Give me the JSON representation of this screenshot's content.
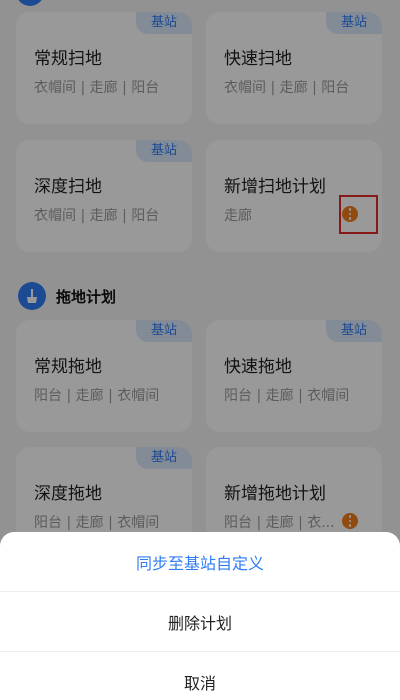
{
  "badge_label": "基站",
  "section": {
    "title": "拖地计划"
  },
  "cards": [
    {
      "title": "常规扫地",
      "rooms": "衣帽间 | 走廊 | 阳台"
    },
    {
      "title": "快速扫地",
      "rooms": "衣帽间 | 走廊 | 阳台"
    },
    {
      "title": "深度扫地",
      "rooms": "衣帽间 | 走廊 | 阳台"
    },
    {
      "title": "新增扫地计划",
      "rooms": "走廊"
    },
    {
      "title": "常规拖地",
      "rooms": "阳台 | 走廊 | 衣帽间"
    },
    {
      "title": "快速拖地",
      "rooms": "阳台 | 走廊 | 衣帽间"
    },
    {
      "title": "深度拖地",
      "rooms": "阳台 | 走廊 | 衣帽间"
    },
    {
      "title": "新增拖地计划",
      "rooms": "阳台 | 走廊 | 衣..."
    }
  ],
  "sheet": {
    "sync": "同步至基站自定义",
    "delete": "删除计划",
    "cancel": "取消"
  },
  "colors": {
    "accent": "#2f7cf6",
    "more": "#ef7d1b",
    "highlight": "#e22b2b"
  },
  "icons": {
    "section": "mop-icon",
    "more": "more-icon"
  }
}
